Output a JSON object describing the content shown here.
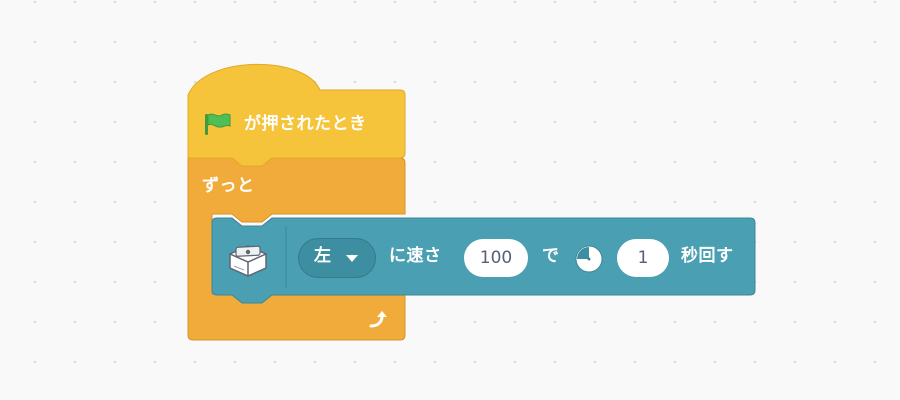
{
  "workspace": {
    "background": "#f9f9f9",
    "grid_dot_color": "#d9dce1"
  },
  "colors": {
    "events": "#f5c43a",
    "events_stroke": "#e2a828",
    "control": "#f1ab3a",
    "control_stroke": "#d7922c",
    "motor": "#4a9fb3",
    "motor_stroke": "#3c8797",
    "motor_dropdown": "#3c8ea0",
    "flag": "#4caf50"
  },
  "hat_block": {
    "icon": "green-flag-icon",
    "label": "が押されたとき"
  },
  "forever_block": {
    "label": "ずっと",
    "loop_icon": "loop-arrow-icon"
  },
  "motor_block": {
    "icon": "motor-icon",
    "direction": "左",
    "speed_label": "に速さ",
    "speed_value": "100",
    "de_label": "で",
    "clock_icon": "clock-icon",
    "seconds_value": "1",
    "seconds_label": "秒回す"
  }
}
